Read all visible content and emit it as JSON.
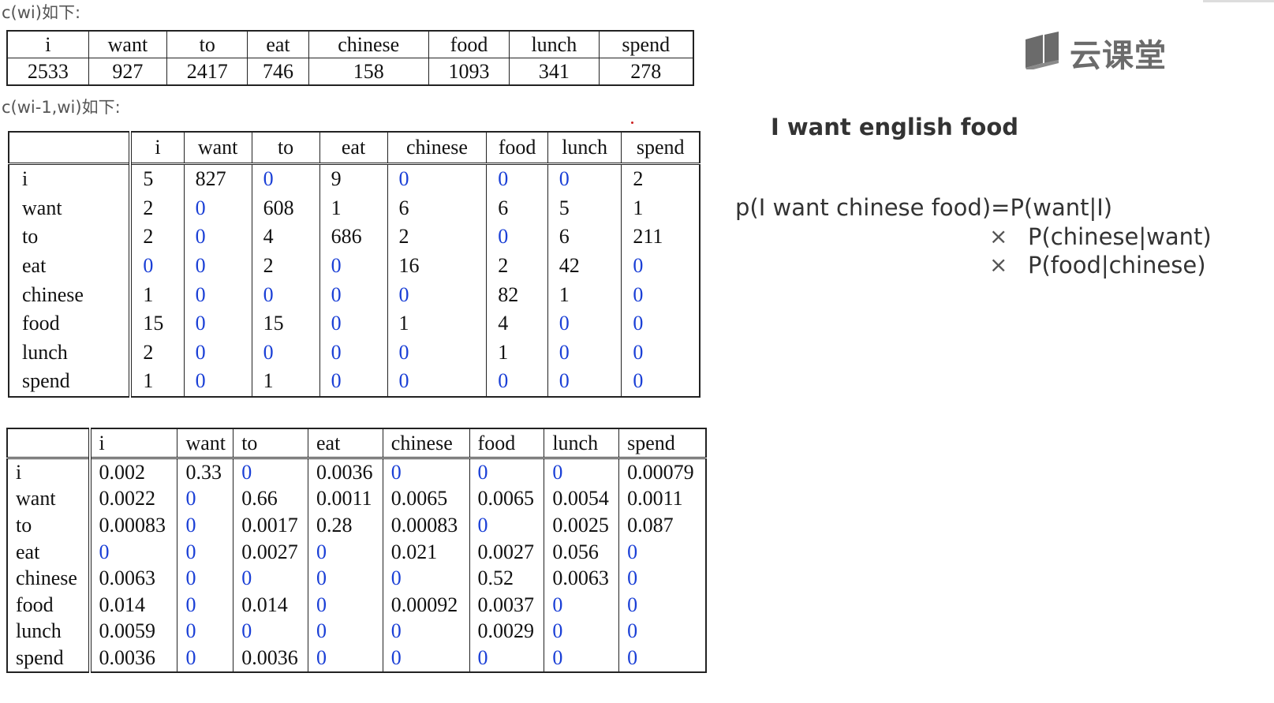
{
  "labels": {
    "unigram": "c(wi)如下:",
    "bigram": "c(wi-1,wi)如下:"
  },
  "unigram_table": {
    "headers": [
      "i",
      "want",
      "to",
      "eat",
      "chinese",
      "food",
      "lunch",
      "spend"
    ],
    "values": [
      "2533",
      "927",
      "2417",
      "746",
      "158",
      "1093",
      "341",
      "278"
    ]
  },
  "count_table": {
    "headers": [
      "",
      "i",
      "want",
      "to",
      "eat",
      "chinese",
      "food",
      "lunch",
      "spend"
    ],
    "rows": [
      [
        "i",
        "5",
        "827",
        "0",
        "9",
        "0",
        "0",
        "0",
        "2"
      ],
      [
        "want",
        "2",
        "0",
        "608",
        "1",
        "6",
        "6",
        "5",
        "1"
      ],
      [
        "to",
        "2",
        "0",
        "4",
        "686",
        "2",
        "0",
        "6",
        "211"
      ],
      [
        "eat",
        "0",
        "0",
        "2",
        "0",
        "16",
        "2",
        "42",
        "0"
      ],
      [
        "chinese",
        "1",
        "0",
        "0",
        "0",
        "0",
        "82",
        "1",
        "0"
      ],
      [
        "food",
        "15",
        "0",
        "15",
        "0",
        "1",
        "4",
        "0",
        "0"
      ],
      [
        "lunch",
        "2",
        "0",
        "0",
        "0",
        "0",
        "1",
        "0",
        "0"
      ],
      [
        "spend",
        "1",
        "0",
        "1",
        "0",
        "0",
        "0",
        "0",
        "0"
      ]
    ]
  },
  "prob_table": {
    "headers": [
      "",
      "i",
      "want",
      "to",
      "eat",
      "chinese",
      "food",
      "lunch",
      "spend"
    ],
    "rows": [
      [
        "i",
        "0.002",
        "0.33",
        "0",
        "0.0036",
        "0",
        "0",
        "0",
        "0.00079"
      ],
      [
        "want",
        "0.0022",
        "0",
        "0.66",
        "0.0011",
        "0.0065",
        "0.0065",
        "0.0054",
        "0.0011"
      ],
      [
        "to",
        "0.00083",
        "0",
        "0.0017",
        "0.28",
        "0.00083",
        "0",
        "0.0025",
        "0.087"
      ],
      [
        "eat",
        "0",
        "0",
        "0.0027",
        "0",
        "0.021",
        "0.0027",
        "0.056",
        "0"
      ],
      [
        "chinese",
        "0.0063",
        "0",
        "0",
        "0",
        "0",
        "0.52",
        "0.0063",
        "0"
      ],
      [
        "food",
        "0.014",
        "0",
        "0.014",
        "0",
        "0.00092",
        "0.0037",
        "0",
        "0"
      ],
      [
        "lunch",
        "0.0059",
        "0",
        "0",
        "0",
        "0",
        "0.0029",
        "0",
        "0"
      ],
      [
        "spend",
        "0.0036",
        "0",
        "0.0036",
        "0",
        "0",
        "0",
        "0",
        "0"
      ]
    ]
  },
  "logo": {
    "text": "云课堂",
    "icon": "book-icon"
  },
  "heading": "I want english food",
  "formula": {
    "line1": "p(I want chinese food)=P(want|I)",
    "times": "×",
    "line2": "P(chinese|want)",
    "line3": "P(food|chinese)"
  },
  "colors": {
    "zero": "#1a3fd6",
    "text": "#111111",
    "logo": "#6b6b6b"
  }
}
